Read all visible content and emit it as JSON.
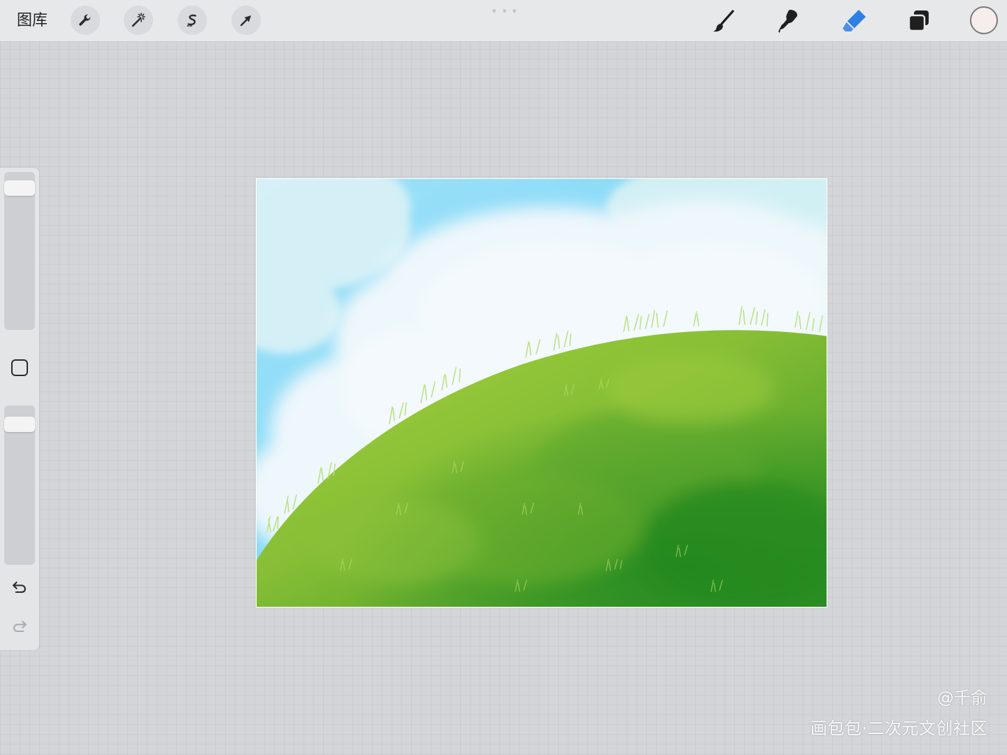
{
  "toolbar": {
    "gallery_label": "图库",
    "left_tools": [
      {
        "icon": "wrench-icon",
        "name": "actions"
      },
      {
        "icon": "magic-wand-icon",
        "name": "adjustments"
      },
      {
        "icon": "selection-s-icon",
        "name": "selection"
      },
      {
        "icon": "arrow-cursor-icon",
        "name": "transform"
      }
    ],
    "right_tools": [
      {
        "icon": "brush-icon",
        "name": "paint"
      },
      {
        "icon": "smudge-icon",
        "name": "smudge"
      },
      {
        "icon": "eraser-icon",
        "name": "erase",
        "active": true
      },
      {
        "icon": "layers-icon",
        "name": "layers"
      }
    ],
    "active_color": "#f6eeec",
    "active_tool_color": "#2f7fe6"
  },
  "sidebar": {
    "brush_size": 0.96,
    "opacity": 0.94,
    "icons": [
      "square-modify-icon",
      "undo-icon",
      "redo-icon"
    ]
  },
  "watermark": {
    "author": "@千俞",
    "site": "画包包·二次元文创社区"
  }
}
